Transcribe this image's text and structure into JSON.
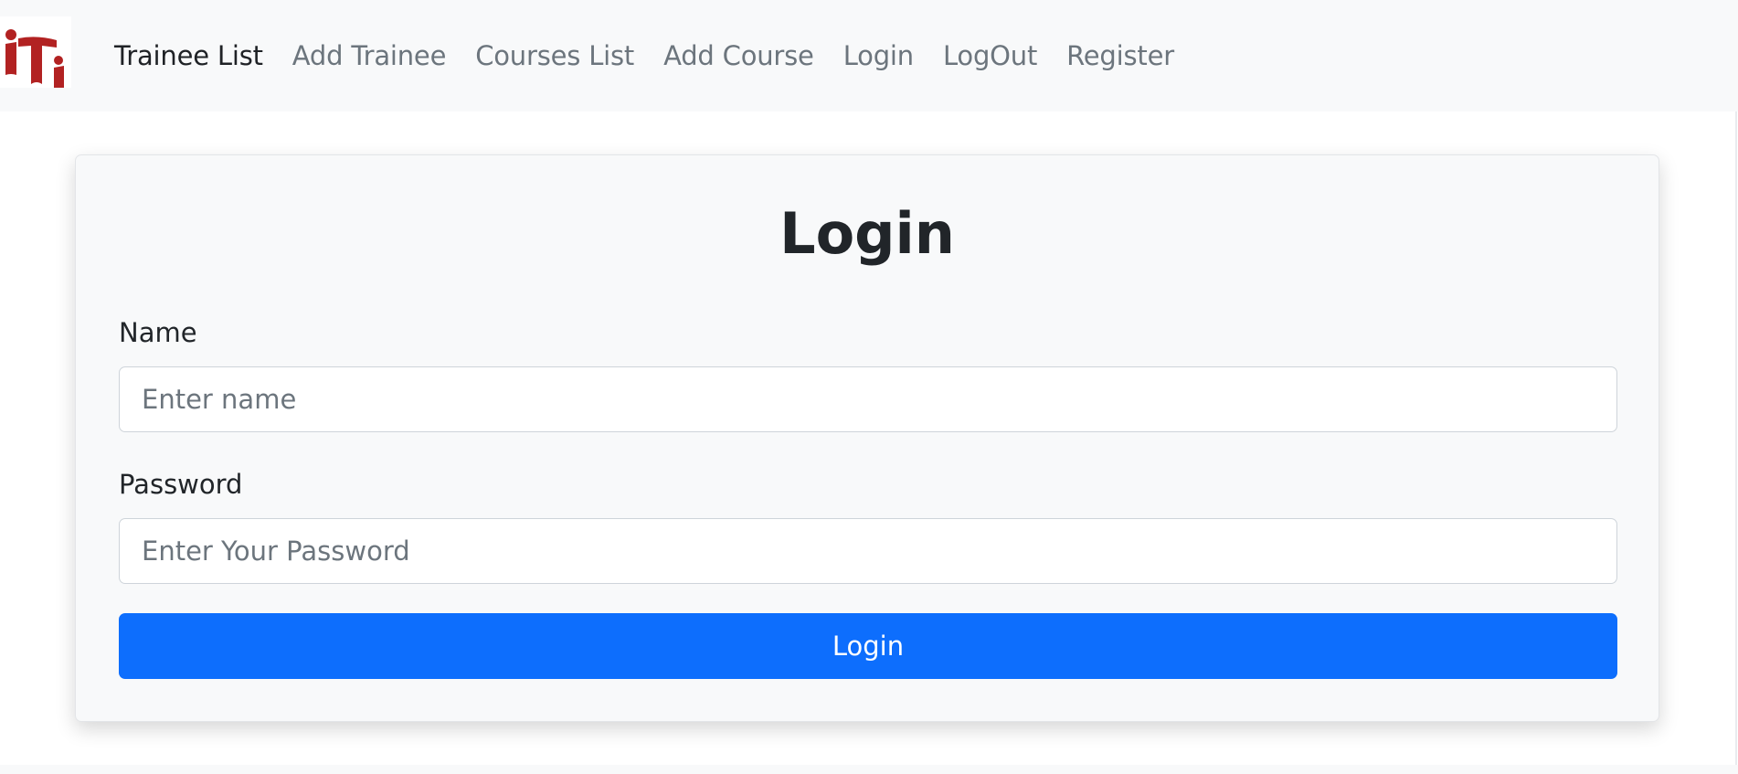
{
  "navbar": {
    "logo": {
      "icon": "iti-logo",
      "color": "#b22222"
    },
    "links": [
      {
        "label": "Trainee List",
        "active": true
      },
      {
        "label": "Add Trainee",
        "active": false
      },
      {
        "label": "Courses List",
        "active": false
      },
      {
        "label": "Add Course",
        "active": false
      },
      {
        "label": "Login",
        "active": false
      },
      {
        "label": "LogOut",
        "active": false
      },
      {
        "label": "Register",
        "active": false
      }
    ]
  },
  "form": {
    "title": "Login",
    "name": {
      "label": "Name",
      "placeholder": "Enter name",
      "value": ""
    },
    "password": {
      "label": "Password",
      "placeholder": "Enter Your Password",
      "value": ""
    },
    "submit_label": "Login"
  },
  "colors": {
    "primary": "#0d6efd",
    "navbar_bg": "#f8f9fa",
    "text_dark": "#212529",
    "text_muted": "#6c757d"
  }
}
